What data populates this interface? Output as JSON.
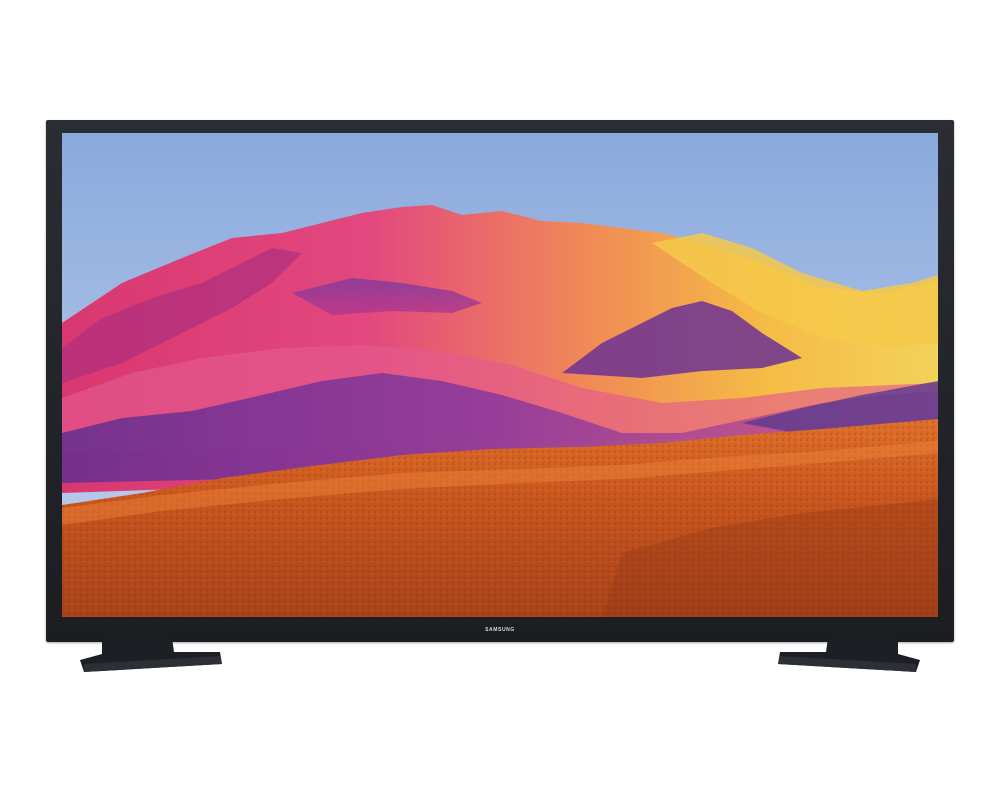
{
  "product": {
    "brand_logo": "SAMSUNG",
    "type": "tv-product-photo"
  },
  "colors": {
    "bezel": "#1f2226",
    "background": "#ffffff",
    "sky": "#9bb8e3",
    "mountain_magenta": "#d03a8a",
    "mountain_gold": "#f2c23c",
    "desert_orange": "#d25a1f"
  },
  "icons": {
    "left_stand": "tv-foot-left",
    "right_stand": "tv-foot-right"
  }
}
